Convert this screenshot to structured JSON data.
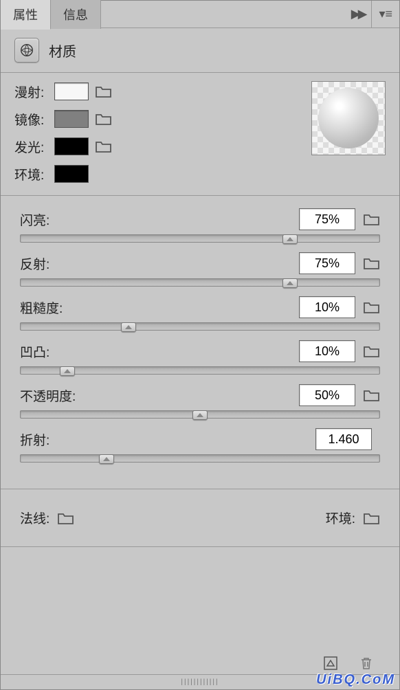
{
  "tabs": {
    "properties": "属性",
    "info": "信息"
  },
  "header": {
    "title": "材质"
  },
  "swatches": {
    "diffuse": {
      "label": "漫射:",
      "color": "#f7f7f7"
    },
    "mirror": {
      "label": "镜像:",
      "color": "#808080"
    },
    "glow": {
      "label": "发光:",
      "color": "#000000"
    },
    "ambient": {
      "label": "环境:",
      "color": "#000000"
    }
  },
  "sliders": {
    "shine": {
      "label": "闪亮:",
      "value": "75%",
      "pos": 75
    },
    "reflect": {
      "label": "反射:",
      "value": "75%",
      "pos": 75
    },
    "roughness": {
      "label": "粗糙度:",
      "value": "10%",
      "pos": 30
    },
    "bump": {
      "label": "凹凸:",
      "value": "10%",
      "pos": 13
    },
    "opacity": {
      "label": "不透明度:",
      "value": "50%",
      "pos": 50
    },
    "refraction": {
      "label": "折射:",
      "value": "1.460",
      "pos": 24
    }
  },
  "normal": {
    "label": "法线:",
    "env_label": "环境:"
  },
  "watermark": "UiBQ.CoM"
}
